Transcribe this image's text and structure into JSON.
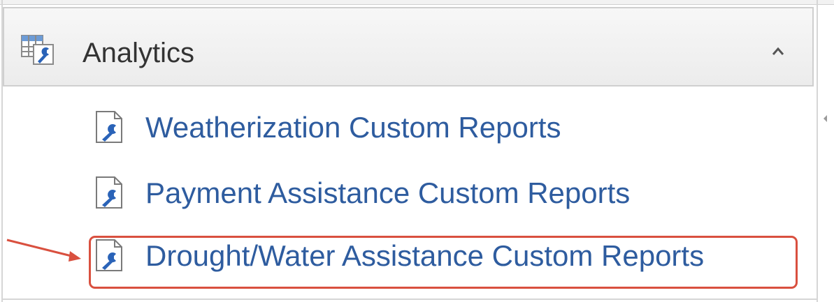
{
  "section": {
    "title": "Analytics",
    "header_icon": "analytics-report-icon",
    "collapse_icon": "chevron-up-icon"
  },
  "items": [
    {
      "label": "Weatherization Custom Reports",
      "icon": "report-wrench-icon"
    },
    {
      "label": "Payment Assistance Custom Reports",
      "icon": "report-wrench-icon"
    },
    {
      "label": "Drought/Water Assistance Custom Reports",
      "icon": "report-wrench-icon",
      "highlighted": true
    }
  ],
  "colors": {
    "link": "#2e5c9f",
    "header_text": "#333333",
    "highlight": "#d9503f",
    "icon_blue": "#2a63b8"
  }
}
